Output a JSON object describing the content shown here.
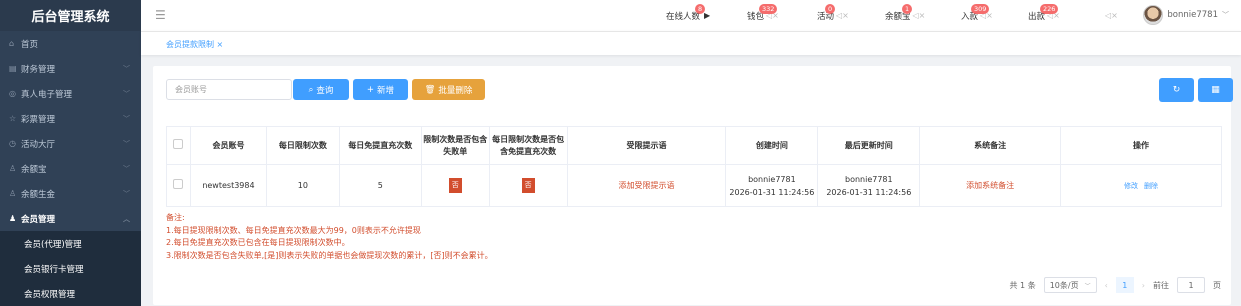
{
  "app_title": "后台管理系统",
  "sidebar": {
    "items": [
      {
        "icon": "⌂",
        "label": "首页"
      },
      {
        "icon": "▤",
        "label": "财务管理"
      },
      {
        "icon": "◎",
        "label": "真人电子管理"
      },
      {
        "icon": "☆",
        "label": "彩票管理"
      },
      {
        "icon": "◷",
        "label": "活动大厅"
      },
      {
        "icon": "♙",
        "label": "余额宝"
      },
      {
        "icon": "♙",
        "label": "余额生金"
      }
    ],
    "active": {
      "icon": "♟",
      "label": "会员管理"
    },
    "sub_items": [
      {
        "label": "会员(代理)管理"
      },
      {
        "label": "会员银行卡管理"
      },
      {
        "label": "会员权限管理"
      }
    ]
  },
  "header": {
    "online": {
      "label": "在线人数",
      "badge": "8"
    },
    "wallet": {
      "label": "钱包",
      "badge": "332"
    },
    "activity": {
      "label": "活动",
      "badge": "0"
    },
    "yuebao": {
      "label": "余额宝",
      "badge": "1"
    },
    "deposit": {
      "label": "入款",
      "badge": "309"
    },
    "withdraw": {
      "label": "出款",
      "badge": "226"
    },
    "username": "bonnie7781"
  },
  "tab": {
    "label": "会员提款限制 ×"
  },
  "toolbar": {
    "search_placeholder": "会员账号",
    "query_label": "查询",
    "add_label": "新增",
    "batch_delete_label": "批量删除"
  },
  "table": {
    "headers": [
      "会员账号",
      "每日限制次数",
      "每日免提直充次数",
      "限制次数是否包含失败单",
      "每日限制次数是否包含免提直充次数",
      "受限提示语",
      "创建时间",
      "最后更新时间",
      "系统备注",
      "操作"
    ],
    "rows": [
      {
        "account": "newtest3984",
        "daily_limit": "10",
        "free_direct": "5",
        "include_failed": "否",
        "include_free": "否",
        "prompt": "添加受限提示语",
        "created_by": "bonnie7781",
        "created_at": "2026-01-31 11:24:56",
        "updated_by": "bonnie7781",
        "updated_at": "2026-01-31 11:24:56",
        "remark": "添加系统备注",
        "edit": "修改",
        "delete": "删除"
      }
    ]
  },
  "notes": [
    "备注:",
    "1.每日提现限制次数、每日免提直充次数最大为99，0则表示不允许提现",
    "2.每日免提直充次数已包含在每日提现限制次数中。",
    "3.限制次数是否包含失败单,[是]则表示失败的单据也会做提现次数的累计，[否]则不会累计。"
  ],
  "pagination": {
    "total": "共 1 条",
    "page_size": "10条/页",
    "current": "1",
    "goto_label": "前往",
    "goto_value": "1",
    "page_unit": "页"
  }
}
